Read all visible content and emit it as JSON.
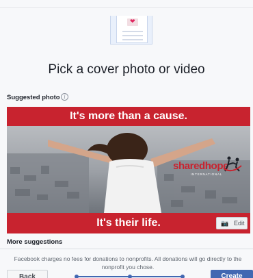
{
  "dialog": {
    "title": "Pick a cover photo or video",
    "suggested_label": "Suggested photo",
    "info_icon": "info-icon",
    "info_glyph": "i",
    "more_label": "More suggestions",
    "fees_text": "Facebook charges no fees for donations to nonprofits. All donations will go directly to the nonprofit you chose.",
    "back_label": "Back",
    "create_label": "Create",
    "accent": "#4267b2",
    "illustration_glyph": "❤"
  },
  "cover": {
    "top_banner": "It's more than a cause.",
    "bottom_banner": "It's their life.",
    "logo_text": "sharedhope",
    "logo_sub": "INTERNATIONAL",
    "edit_label": "Edit",
    "edit_icon": "camera-icon",
    "edit_glyph": "📷",
    "banner_color": "#c8232f"
  },
  "progress_steps": {
    "total": 3,
    "current": 3
  }
}
